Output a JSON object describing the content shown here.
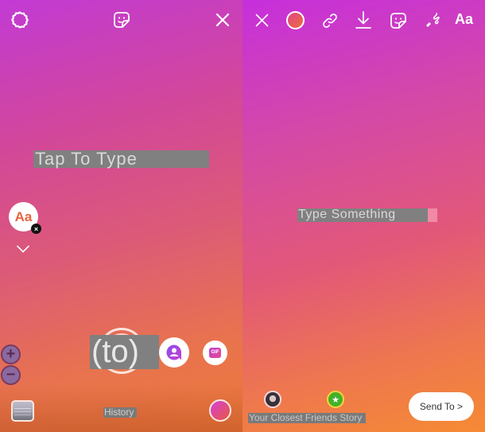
{
  "left_panel": {
    "top_bar": {
      "settings_icon": "gear-icon",
      "sticker_icon": "sticker-icon",
      "close_icon": "close-icon"
    },
    "text_placeholder": "Tap To Type",
    "font_button": {
      "label": "Aa",
      "badge": "×"
    },
    "collapse_icon": "chevron-down-icon",
    "zoom_in": "+",
    "zoom_out": "−",
    "shutter_label": "(to)",
    "mention_icon": "mention-icon",
    "gif_label": "GIF",
    "history_label": "History",
    "color_picker_icon": "color-orb-icon"
  },
  "right_panel": {
    "top_bar": {
      "close_icon": "close-icon",
      "color_icon": "color-orb-icon",
      "link_icon": "link-icon",
      "download_icon": "download-icon",
      "sticker_icon": "sticker-icon",
      "draw_icon": "draw-icon",
      "text_label": "Aa"
    },
    "text_placeholder": "Type Something",
    "audience_label": "Your Closest Friends Story",
    "closest_friends_icon": "★",
    "send_button": "Send To >"
  },
  "colors": {
    "gradient_top": "#c23ad4",
    "gradient_bottom": "#ec7a3a",
    "closest_friends_green": "#44b02a",
    "font_button_accent": "#e9623f"
  }
}
